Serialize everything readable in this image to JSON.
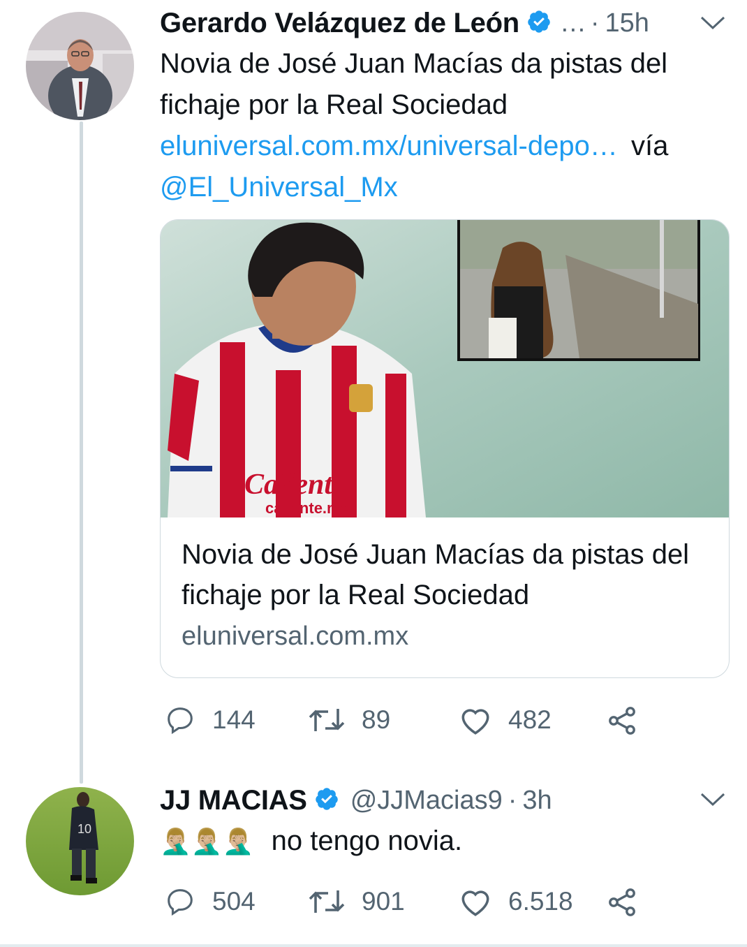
{
  "tweets": [
    {
      "author": "Gerardo Velázquez de León",
      "handle": "…",
      "separator": "·",
      "time": "15h",
      "text_line1": "Novia de José Juan Macías da pistas del",
      "text_line2": "fichaje por la Real Sociedad",
      "link": "eluniversal.com.mx/universal-depo…",
      "via": "vía",
      "mention": "@El_Universal_Mx",
      "card": {
        "title": "Novia de José Juan Macías da pistas del fichaje por la Real Sociedad",
        "domain": "eluniversal.com.mx"
      },
      "stats": {
        "replies": "144",
        "retweets": "89",
        "likes": "482"
      }
    },
    {
      "author": "JJ MACIAS",
      "handle": "@JJMacias9",
      "separator": "·",
      "time": "3h",
      "emojis": "🤦🏼‍♂️🤦🏼‍♂️🤦🏼‍♂️",
      "text": "no tengo novia.",
      "stats": {
        "replies": "504",
        "retweets": "901",
        "likes": "6.518"
      }
    }
  ],
  "colors": {
    "link": "#1d9bf0",
    "verified": "#1d9bf0",
    "secondary": "#536471"
  },
  "icons": [
    "verified-badge-icon",
    "chevron-down-icon",
    "reply-icon",
    "retweet-icon",
    "like-icon",
    "share-icon"
  ]
}
